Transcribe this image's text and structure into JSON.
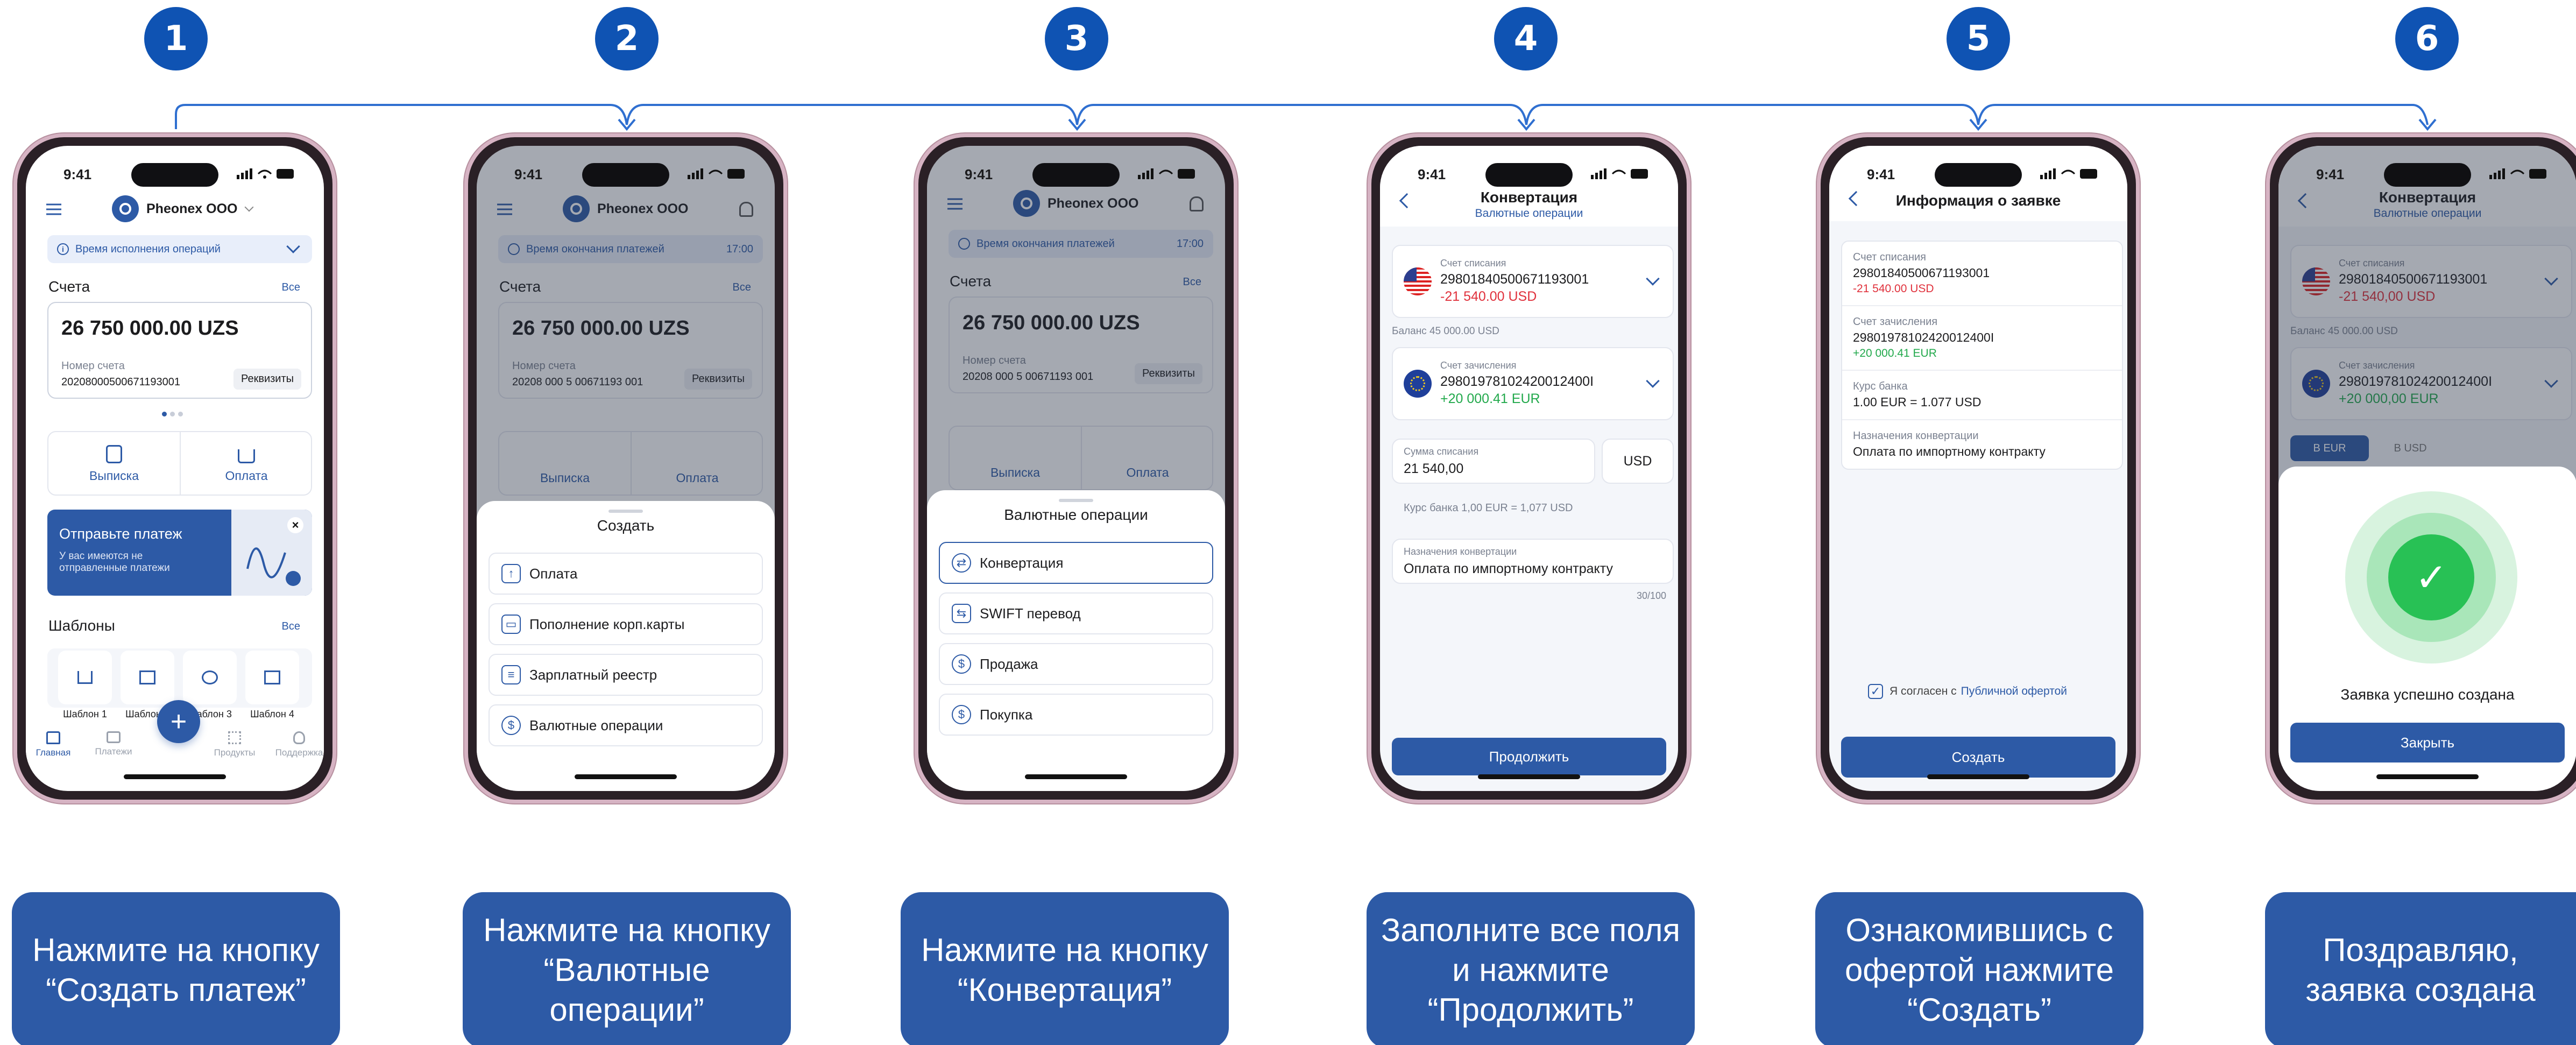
{
  "steps": [
    {
      "num": "1",
      "cap": "Нажмите на кнопку “Создать платеж”"
    },
    {
      "num": "2",
      "cap": "Нажмите на кнопку “Валютные операции”"
    },
    {
      "num": "3",
      "cap": "Нажмите на кнопку “Конвертация”"
    },
    {
      "num": "4",
      "cap": "Заполните все поля и нажмите “Продолжить”"
    },
    {
      "num": "5",
      "cap": "Ознакомившись с офертой нажмите “Создать”"
    },
    {
      "num": "6",
      "cap": "Поздравляю, заявка создана"
    }
  ],
  "colors": {
    "accent": "#2d5aa6",
    "badge": "#0f53b3",
    "danger": "#e0313c",
    "success": "#22a94c"
  },
  "status": {
    "time": "9:41"
  },
  "home": {
    "company": "Pheonex OOO",
    "notice": "Время исполнения операций",
    "accounts_title": "Счета",
    "all": "Все",
    "balance": "26 750 000.00 UZS",
    "acc_label": "Номер счета",
    "acc_number": "20208000500671193001",
    "details": "Реквизиты",
    "statement": "Выписка",
    "payment": "Оплата",
    "promo_title": "Отправьте платеж",
    "promo_text": "У вас имеются не отправленные платежи",
    "templates_title": "Шаблоны",
    "templates": [
      "Шаблон 1",
      "Шаблон 2",
      "Шаблон 3",
      "Шаблон 4"
    ],
    "nav": [
      "Главная",
      "Платежи",
      "Продукты",
      "Поддержка"
    ]
  },
  "bg": {
    "notice": "Время окончания платежей",
    "notice_time": "17:00",
    "acc_number": "20208 000 5 00671193 001"
  },
  "create": {
    "title": "Создать",
    "items": [
      "Оплата",
      "Пополнение корп.карты",
      "Зарплатный реестр",
      "Валютные операции"
    ]
  },
  "currency": {
    "title": "Валютные операции",
    "items": [
      "Конвертация",
      "SWIFT перевод",
      "Продажа",
      "Покупка"
    ]
  },
  "conv": {
    "title": "Конвертация",
    "subtitle": "Валютные операции",
    "debit_label": "Счет списания",
    "debit_acc": "29801840500671193001",
    "debit_amount": "-21 540.00 USD",
    "balance": "Баланс 45 000.00 USD",
    "credit_label": "Счет зачисления",
    "credit_acc": "29801978102420012400I",
    "credit_amount": "+20 000.41 EUR",
    "sum_label": "Сумма списания",
    "sum_value": "21 540,00",
    "sum_currency": "USD",
    "rate": "Курс банка 1,00 EUR = 1,077 USD",
    "purpose_label": "Назначения конвертации",
    "purpose_value": "Оплата по импортному контракту",
    "counter": "30/100",
    "continue": "Продолжить"
  },
  "info": {
    "title": "Информация о заявке",
    "debit_label": "Счет списания",
    "debit_acc": "29801840500671193001",
    "debit_amount": "-21 540.00 USD",
    "credit_label": "Счет зачисления",
    "credit_acc": "29801978102420012400I",
    "credit_amount": "+20 000.41 EUR",
    "rate_label": "Курс банка",
    "rate_value": "1.00 EUR = 1.077 USD",
    "purpose_label": "Назначения конвертации",
    "purpose_value": "Оплата по импортному контракту",
    "agree": "Я согласен с",
    "offer": "Публичной офертой",
    "create": "Создать"
  },
  "done": {
    "title": "Конвертация",
    "subtitle": "Валютные операции",
    "debit_label": "Счет списания",
    "debit_acc": "29801840500671193001",
    "debit_amount": "-21 540,00 USD",
    "balance": "Баланс 45 000.00 USD",
    "credit_label": "Счет зачисления",
    "credit_acc": "29801978102420012400I",
    "credit_amount": "+20 000,00 EUR",
    "tab1": "В EUR",
    "tab2": "В USD",
    "success": "Заявка успешно создана",
    "close": "Закрыть"
  }
}
